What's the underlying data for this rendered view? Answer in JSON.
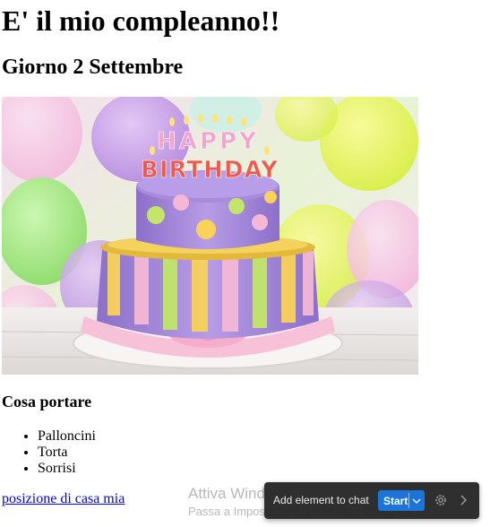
{
  "page": {
    "title": "E' il mio compleanno!!",
    "subtitle": "Giorno 2 Settembre"
  },
  "hero_image": {
    "topper_word_1": "HAPPY",
    "topper_word_2": "BIRTHDAY"
  },
  "bring": {
    "heading": "Cosa portare",
    "items": [
      "Palloncini",
      "Torta",
      "Sorrisi"
    ]
  },
  "links": {
    "home_location": "posizione di casa mia"
  },
  "windows_watermark": {
    "title": "Attiva Windows",
    "subtitle": "Passa a Impostazioni per attivare Windows."
  },
  "chat_toolbar": {
    "add_label": "Add element to chat",
    "start_label": "Start",
    "icons": [
      "chevron-down-icon",
      "gear-icon",
      "chevron-right-icon"
    ]
  },
  "colors": {
    "link": "#0000ee",
    "toolbar_bg": "#242424",
    "start_button": "#1a74d9"
  }
}
